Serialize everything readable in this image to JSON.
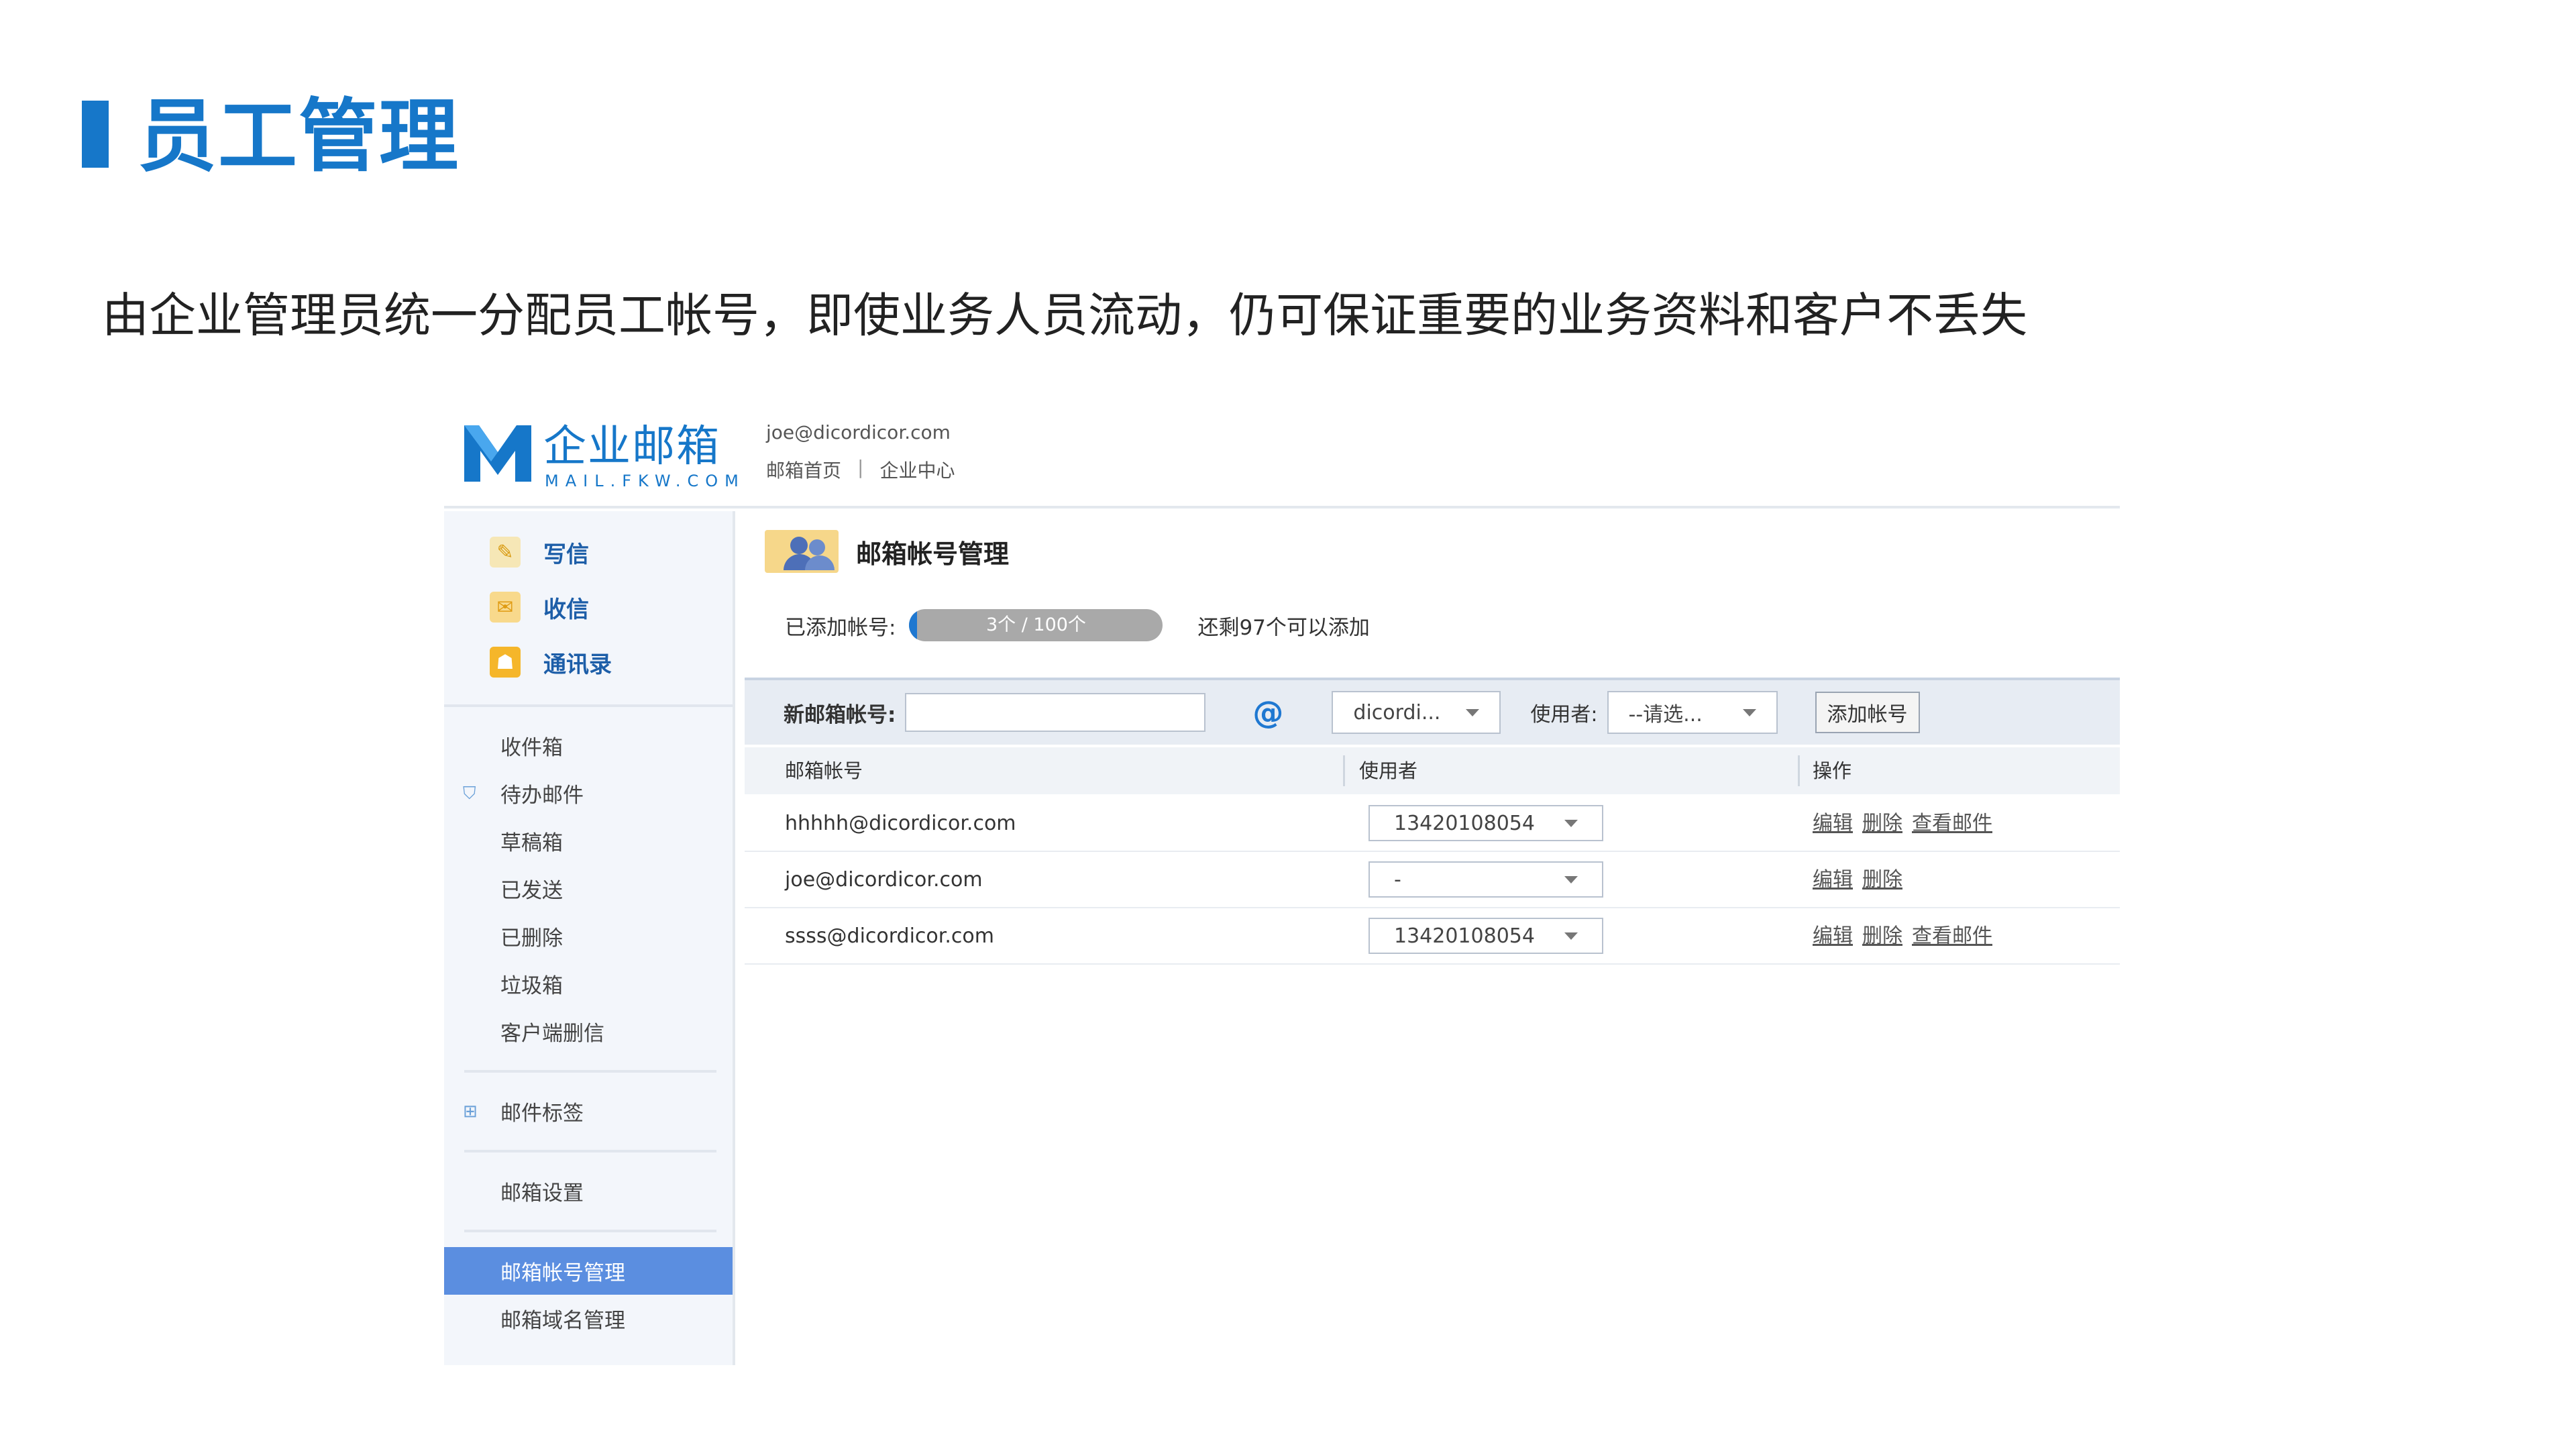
{
  "slide": {
    "title": "员工管理",
    "subtitle": "由企业管理员统一分配员工帐号，即使业务人员流动，仍可保证重要的业务资料和客户不丢失"
  },
  "app": {
    "logo_text": "企业邮箱",
    "logo_sub": "MAIL.FKW.COM",
    "user_email": "joe@dicordicor.com",
    "top_links": [
      "邮箱首页",
      "企业中心"
    ],
    "top_links_sep": "|"
  },
  "sidebar": {
    "quick": [
      {
        "label": "写信",
        "icon": "pencil-icon"
      },
      {
        "label": "收信",
        "icon": "envelope-icon"
      },
      {
        "label": "通讯录",
        "icon": "contacts-icon"
      }
    ],
    "folders": [
      "收件箱",
      "待办邮件",
      "草稿箱",
      "已发送",
      "已删除",
      "垃圾箱",
      "客户端删信"
    ],
    "tags": "邮件标签",
    "settings": "邮箱设置",
    "admin": [
      "邮箱帐号管理",
      "邮箱域名管理"
    ]
  },
  "panel": {
    "title": "邮箱帐号管理",
    "quota_label": "已添加帐号:",
    "quota_text": "3个 / 100个",
    "quota_used": 3,
    "quota_total": 100,
    "quota_remain": "还剩97个可以添加",
    "add_label": "新邮箱帐号:",
    "at": "@",
    "domain_select": "dicordi...",
    "user_label": "使用者:",
    "user_select": "--请选...",
    "add_button": "添加帐号",
    "columns": [
      "邮箱帐号",
      "使用者",
      "操作"
    ],
    "rows": [
      {
        "account": "hhhhh@dicordicor.com",
        "user": "13420108054",
        "ops": [
          "编辑",
          "删除",
          "查看邮件"
        ]
      },
      {
        "account": "joe@dicordicor.com",
        "user": "-",
        "ops": [
          "编辑",
          "删除"
        ]
      },
      {
        "account": "ssss@dicordicor.com",
        "user": "13420108054",
        "ops": [
          "编辑",
          "删除",
          "查看邮件"
        ]
      }
    ]
  },
  "colors": {
    "accent": "#1677c9",
    "active_item": "#5b8ee0",
    "sidebar_bg": "#f3f6fb"
  }
}
